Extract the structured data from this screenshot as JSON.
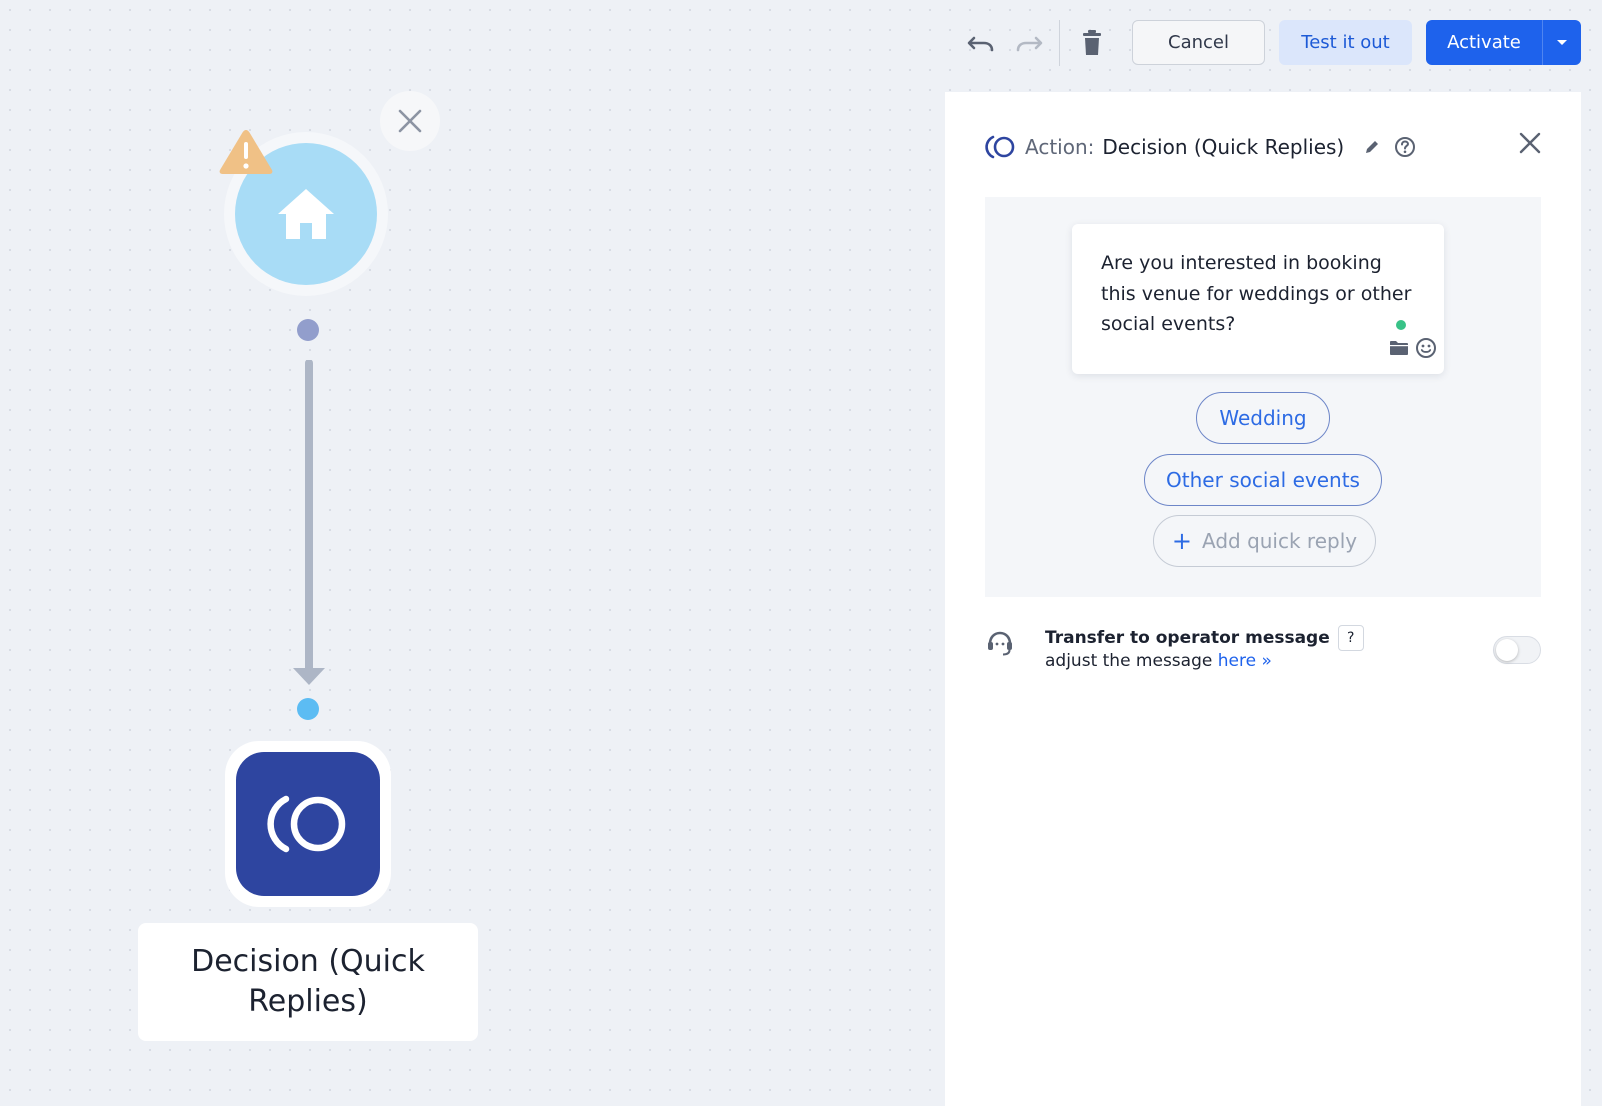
{
  "toolbar": {
    "undo_icon": "undo-icon",
    "redo_icon": "redo-icon",
    "delete_icon": "trash-icon",
    "cancel_label": "Cancel",
    "test_label": "Test it out",
    "activate_label": "Activate"
  },
  "canvas": {
    "start_node_icon": "home-icon",
    "warning_icon": "warning-icon",
    "decision_node_icon": "quick-replies-icon",
    "decision_node_label": "Decision (Quick Replies)"
  },
  "panel": {
    "prefix": "Action:",
    "title": "Decision (Quick Replies)",
    "message_text": "Are you interested in booking this venue for weddings or other social events?",
    "quick_replies": [
      {
        "label": "Wedding"
      },
      {
        "label": "Other social events"
      }
    ],
    "add_quick_reply_plus": "+",
    "add_quick_reply_label": "Add quick reply",
    "transfer": {
      "title": "Transfer to operator message",
      "help": "?",
      "sub_text": "adjust the message",
      "link_text": "here »",
      "enabled": false
    }
  },
  "colors": {
    "primary": "#1e62ec",
    "decision_node": "#2e45a0",
    "start_node": "#a8dcf6",
    "warning": "#f0c186",
    "online_dot": "#38c287"
  }
}
